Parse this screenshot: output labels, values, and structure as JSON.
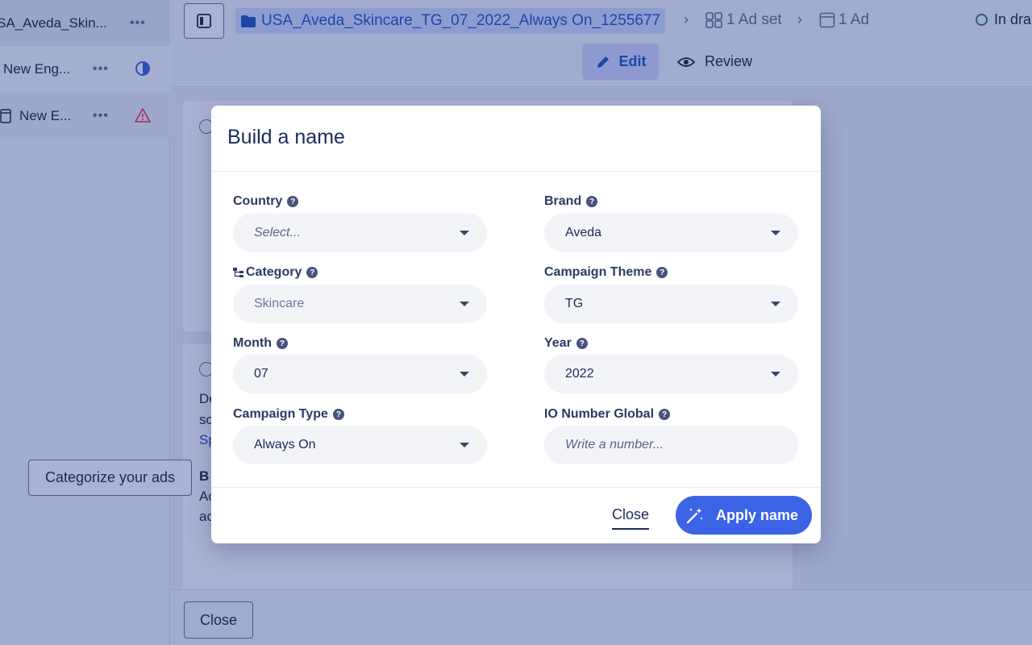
{
  "sidebar": {
    "items": [
      {
        "label": "SA_Aveda_Skin...",
        "menu": "•••",
        "status": "none"
      },
      {
        "label": "New Eng...",
        "menu": "•••",
        "status": "half-circle-icon"
      },
      {
        "label": "New E...",
        "menu": "•••",
        "status": "warning-icon"
      }
    ]
  },
  "topbar": {
    "campaign_name": "USA_Aveda_Skincare_TG_07_2022_Always On_1255677",
    "ad_set": "1 Ad set",
    "ad": "1 Ad",
    "status": "In dra",
    "tabs": {
      "edit": "Edit",
      "review": "Review"
    }
  },
  "background": {
    "card2": {
      "line1": "De",
      "line2": "sc",
      "link": "Sp",
      "heading": "B",
      "line3": "Ac",
      "line4": "ac"
    },
    "categorize_button": "Categorize your ads",
    "footer_close": "Close"
  },
  "modal": {
    "title": "Build a name",
    "fields": {
      "country": {
        "label": "Country",
        "value": "Select...",
        "placeholder": true
      },
      "brand": {
        "label": "Brand",
        "value": "Aveda"
      },
      "category": {
        "label": "Category",
        "value": "Skincare"
      },
      "campaign_theme": {
        "label": "Campaign Theme",
        "value": "TG"
      },
      "month": {
        "label": "Month",
        "value": "07"
      },
      "year": {
        "label": "Year",
        "value": "2022"
      },
      "campaign_type": {
        "label": "Campaign Type",
        "value": "Always On"
      },
      "io_number_global": {
        "label": "IO Number Global",
        "placeholder": "Write a number..."
      }
    },
    "close_label": "Close",
    "apply_label": "Apply name"
  },
  "colors": {
    "overlay": "#a4aed1",
    "primary": "#3a63e6",
    "field_bg": "#f3f4f8",
    "warning": "#a0304a"
  }
}
